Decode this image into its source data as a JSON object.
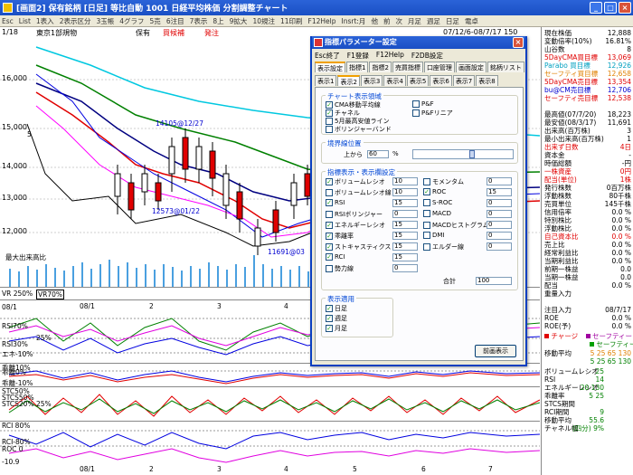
{
  "window": {
    "title": "[画面2] 保有銘柄 [日足] 等比自動  1001  日経平均株価  分割調整チャート"
  },
  "menu": [
    "Esc",
    "List",
    "1表入",
    "2表示区分",
    "3玉帳",
    "4グラフ",
    "5売",
    "6注目",
    "7表示",
    "8上",
    "9拡大",
    "10規注",
    "11印刷",
    "F12Help",
    "Insrt:月",
    "他",
    "前",
    "次",
    "月足",
    "週足",
    "日足",
    "電卓"
  ],
  "chart_header": {
    "date": "1/18",
    "name": "東京1部規物",
    "status": "保有",
    "tag1": "買候補",
    "tag2": "発注",
    "range": "07/12/6-08/7/17 150"
  },
  "main_axis": [
    "16,000",
    "15,000",
    "14,000",
    "13,000",
    "12,000"
  ],
  "price_labels": {
    "p1": "14105",
    "p1b": "12/27",
    "p2": "12573",
    "p2b": "01/22",
    "p3": "11691",
    "p3b": "03",
    "label5": "5"
  },
  "volume_label": "最大出来高比",
  "panels": {
    "vr_top": "VR 250%",
    "vr_box": "VR70%",
    "date_labels": [
      "08/1",
      "2",
      "3",
      "4",
      "5",
      "6",
      "7"
    ],
    "rsi_top": "RSI70%",
    "rsi_mid": "RSI30%",
    "rsi_low": "エネ-10%",
    "rsi_25": "25%",
    "kairi_top": "乖離10%",
    "kairi_mid": "乖離0%",
    "kairi_low": "乖離-10%",
    "stc1": "STC50%",
    "stc2": "STCS50%",
    "stc3": "STCS20%",
    "stc4": "25%",
    "rci_top": "RCI 80%",
    "rci_low": "RCI-80%",
    "roc": "ROC 0",
    "bottom": "-10.9"
  },
  "info": {
    "rows": [
      {
        "k": "現在株価",
        "v": "12,888",
        "c": ""
      },
      {
        "k": "変動倍率(10%)",
        "v": "16.81%",
        "c": ""
      },
      {
        "k": "山谷数",
        "v": "8",
        "c": ""
      },
      {
        "k": "5DayCMA買目標",
        "v": "13,069",
        "c": "red"
      },
      {
        "k": "Parabo 買目標",
        "v": "12,926",
        "c": "cyan"
      },
      {
        "k": "セーフティ買目標",
        "v": "12,658",
        "c": "orange"
      },
      {
        "k": "5DayCMA売目標",
        "v": "13,354",
        "c": "red"
      },
      {
        "k": "bu@CM売目標",
        "v": "12,706",
        "c": "blue"
      },
      {
        "k": "セーフティ売目標",
        "v": "12,538",
        "c": "red"
      },
      {
        "k": "",
        "v": "",
        "c": ""
      },
      {
        "k": "最高値(07/7/20)",
        "v": "18,223",
        "c": ""
      },
      {
        "k": "最安値(08/3/17)",
        "v": "11,691",
        "c": ""
      },
      {
        "k": "出来高(百万株)",
        "v": "3",
        "c": ""
      },
      {
        "k": "最小出来高(百万株)",
        "v": "1",
        "c": ""
      },
      {
        "k": "出来ず日数",
        "v": "4日",
        "c": "red"
      },
      {
        "k": "資本金",
        "v": "-",
        "c": ""
      },
      {
        "k": "時価総額",
        "v": "-円",
        "c": ""
      },
      {
        "k": "一株資産",
        "v": "0円",
        "c": "red"
      },
      {
        "k": "配当(単位)",
        "v": "1株",
        "c": "red"
      },
      {
        "k": "発行株数",
        "v": "0百万株",
        "c": ""
      },
      {
        "k": "浮動株数",
        "v": "80千株",
        "c": ""
      },
      {
        "k": "売買単位",
        "v": "145千株",
        "c": ""
      },
      {
        "k": "信用倍率",
        "v": "0.0 %",
        "c": ""
      },
      {
        "k": "特別株比",
        "v": "0.0 %",
        "c": ""
      },
      {
        "k": "浮動株比",
        "v": "0.0 %",
        "c": ""
      },
      {
        "k": "自己資本比",
        "v": "0.0 %",
        "c": "red"
      },
      {
        "k": "売上比",
        "v": "0.0 %",
        "c": ""
      },
      {
        "k": "経常利益比",
        "v": "0.0 %",
        "c": ""
      },
      {
        "k": "当期利益比",
        "v": "0.0 %",
        "c": ""
      },
      {
        "k": "前期一株益",
        "v": "0.0",
        "c": ""
      },
      {
        "k": "当期一株益",
        "v": "0.0",
        "c": ""
      },
      {
        "k": "配当",
        "v": "0.0 %",
        "c": ""
      },
      {
        "k": "重量入力",
        "v": "",
        "c": ""
      },
      {
        "k": "",
        "v": "",
        "c": ""
      },
      {
        "k": "注目入力",
        "v": "08/7/17",
        "c": ""
      },
      {
        "k": "ROE",
        "v": "0.0 %",
        "c": ""
      },
      {
        "k": "ROE(予)",
        "v": "0.0 %",
        "c": ""
      }
    ],
    "legend_charge": "チャージ",
    "legend_safety1": "セーフティー",
    "legend_safety2": "セーフティーバー",
    "ma_label": "移動平均",
    "ma_values": "5 25 65 130",
    "ma_values2": "5 25 65 130",
    "stats": [
      {
        "k": "ボリュームレシオ",
        "v": "25"
      },
      {
        "k": "RSI",
        "v": "14"
      },
      {
        "k": "エネルギーレシオ",
        "v": "20 130"
      },
      {
        "k": "乖離率",
        "v": "5 25"
      },
      {
        "k": "STCS期間",
        "v": ""
      },
      {
        "k": "RCI期間",
        "v": "9"
      },
      {
        "k": "移動平均",
        "v": "55.6"
      },
      {
        "k": "チャネル幅",
        "v": "(四分) 9%"
      }
    ]
  },
  "dialog": {
    "title": "指標パラメーター設定",
    "close": "×",
    "menu": [
      "Esc終了",
      "F1登録",
      "F12Help",
      "F2DB設定"
    ],
    "tabs_row1": [
      "表示設定",
      "指標1",
      "指標2",
      "売買指標",
      "口座管理",
      "画面設定",
      "銘柄リスト"
    ],
    "tabs_row2": [
      "表示1",
      "表示2",
      "表示3",
      "表示4",
      "表示5",
      "表示6",
      "表示7",
      "表示8"
    ],
    "group_chart": "チャート表示領域",
    "chart_opts": [
      {
        "label": "CMA移動平均線",
        "checked": true
      },
      {
        "label": "チャネル",
        "checked": true
      },
      {
        "label": "5月最高安値ライン",
        "checked": false
      },
      {
        "label": "ボリンジャーバンド",
        "checked": false
      }
    ],
    "chart_opts_right": [
      {
        "label": "P&F",
        "checked": false
      },
      {
        "label": "P&Fリニア",
        "checked": false
      }
    ],
    "group_border": "境界線位置",
    "border_label": "上から",
    "border_value": "60",
    "border_unit": "%",
    "border_level": 0.6,
    "group_indicators": "指標表示・表示欄設定",
    "ind_left": [
      {
        "label": "ボリュームレシオ",
        "checked": true,
        "value": "10"
      },
      {
        "label": "ボリュームレシオ線",
        "checked": false,
        "value": "10"
      },
      {
        "label": "RSI",
        "checked": true,
        "value": "15"
      },
      {
        "label": "RSIボリンジャー",
        "checked": false,
        "value": "0"
      },
      {
        "label": "エネルギーレシオ",
        "checked": true,
        "value": "15"
      },
      {
        "label": "乖離率",
        "checked": true,
        "value": "15"
      },
      {
        "label": "ストキャスティクス",
        "checked": true,
        "value": "15"
      },
      {
        "label": "RCI",
        "checked": true,
        "value": "15"
      },
      {
        "label": "勢力線",
        "checked": false,
        "value": "0"
      }
    ],
    "ind_right": [
      {
        "label": "モメンタム",
        "checked": false,
        "value": "0"
      },
      {
        "label": "ROC",
        "checked": true,
        "value": "15"
      },
      {
        "label": "S-ROC",
        "checked": false,
        "value": "0"
      },
      {
        "label": "MACD",
        "checked": false,
        "value": "0"
      },
      {
        "label": "MACDヒストグラム",
        "checked": false,
        "value": "0"
      },
      {
        "label": "DMI",
        "checked": false,
        "value": "0"
      },
      {
        "label": "エルダー線",
        "checked": false,
        "value": "0"
      }
    ],
    "total_label": "合計",
    "total_value": "100",
    "group_apply": "表示適用",
    "apply_opts": [
      {
        "label": "日足",
        "checked": true
      },
      {
        "label": "週足",
        "checked": true
      },
      {
        "label": "月足",
        "checked": true
      }
    ],
    "prev_button": "前画表示"
  }
}
